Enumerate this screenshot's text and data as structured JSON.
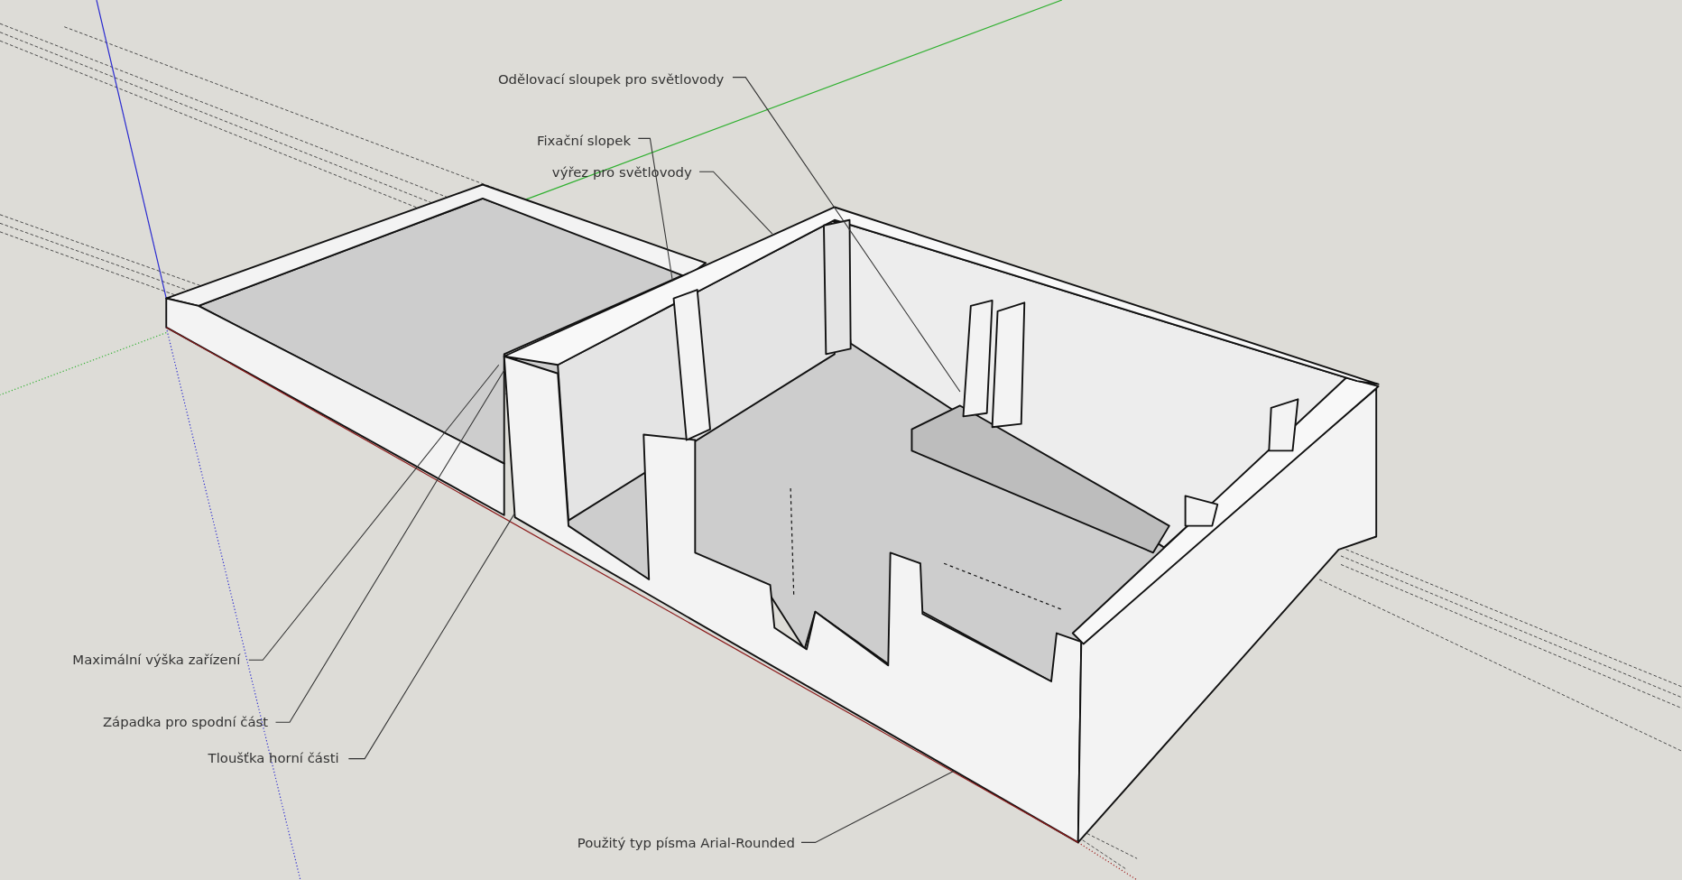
{
  "viewport": {
    "labels": [
      {
        "text": "Odělovací sloupek pro světlovody"
      },
      {
        "text": "Fixační slopek"
      },
      {
        "text": "výřez pro světlovody"
      },
      {
        "text": "Maximální výška zařízení"
      },
      {
        "text": "Západka pro spodní část"
      },
      {
        "text": "Tloušťka horní části"
      },
      {
        "text": "Použitý typ písma Arial-Rounded"
      }
    ]
  }
}
